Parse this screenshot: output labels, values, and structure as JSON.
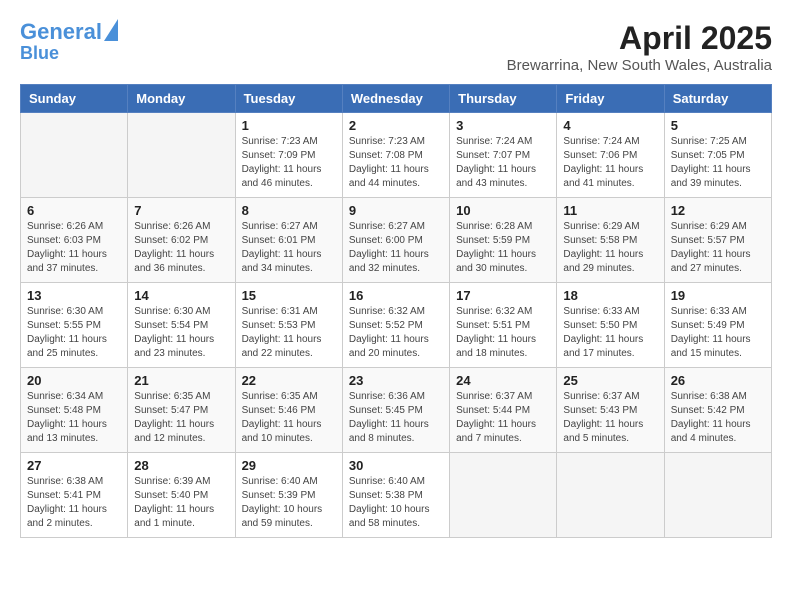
{
  "header": {
    "logo_line1": "General",
    "logo_line2": "Blue",
    "title": "April 2025",
    "subtitle": "Brewarrina, New South Wales, Australia"
  },
  "columns": [
    "Sunday",
    "Monday",
    "Tuesday",
    "Wednesday",
    "Thursday",
    "Friday",
    "Saturday"
  ],
  "weeks": [
    [
      {
        "day": "",
        "info": ""
      },
      {
        "day": "",
        "info": ""
      },
      {
        "day": "1",
        "info": "Sunrise: 7:23 AM\nSunset: 7:09 PM\nDaylight: 11 hours and 46 minutes."
      },
      {
        "day": "2",
        "info": "Sunrise: 7:23 AM\nSunset: 7:08 PM\nDaylight: 11 hours and 44 minutes."
      },
      {
        "day": "3",
        "info": "Sunrise: 7:24 AM\nSunset: 7:07 PM\nDaylight: 11 hours and 43 minutes."
      },
      {
        "day": "4",
        "info": "Sunrise: 7:24 AM\nSunset: 7:06 PM\nDaylight: 11 hours and 41 minutes."
      },
      {
        "day": "5",
        "info": "Sunrise: 7:25 AM\nSunset: 7:05 PM\nDaylight: 11 hours and 39 minutes."
      }
    ],
    [
      {
        "day": "6",
        "info": "Sunrise: 6:26 AM\nSunset: 6:03 PM\nDaylight: 11 hours and 37 minutes."
      },
      {
        "day": "7",
        "info": "Sunrise: 6:26 AM\nSunset: 6:02 PM\nDaylight: 11 hours and 36 minutes."
      },
      {
        "day": "8",
        "info": "Sunrise: 6:27 AM\nSunset: 6:01 PM\nDaylight: 11 hours and 34 minutes."
      },
      {
        "day": "9",
        "info": "Sunrise: 6:27 AM\nSunset: 6:00 PM\nDaylight: 11 hours and 32 minutes."
      },
      {
        "day": "10",
        "info": "Sunrise: 6:28 AM\nSunset: 5:59 PM\nDaylight: 11 hours and 30 minutes."
      },
      {
        "day": "11",
        "info": "Sunrise: 6:29 AM\nSunset: 5:58 PM\nDaylight: 11 hours and 29 minutes."
      },
      {
        "day": "12",
        "info": "Sunrise: 6:29 AM\nSunset: 5:57 PM\nDaylight: 11 hours and 27 minutes."
      }
    ],
    [
      {
        "day": "13",
        "info": "Sunrise: 6:30 AM\nSunset: 5:55 PM\nDaylight: 11 hours and 25 minutes."
      },
      {
        "day": "14",
        "info": "Sunrise: 6:30 AM\nSunset: 5:54 PM\nDaylight: 11 hours and 23 minutes."
      },
      {
        "day": "15",
        "info": "Sunrise: 6:31 AM\nSunset: 5:53 PM\nDaylight: 11 hours and 22 minutes."
      },
      {
        "day": "16",
        "info": "Sunrise: 6:32 AM\nSunset: 5:52 PM\nDaylight: 11 hours and 20 minutes."
      },
      {
        "day": "17",
        "info": "Sunrise: 6:32 AM\nSunset: 5:51 PM\nDaylight: 11 hours and 18 minutes."
      },
      {
        "day": "18",
        "info": "Sunrise: 6:33 AM\nSunset: 5:50 PM\nDaylight: 11 hours and 17 minutes."
      },
      {
        "day": "19",
        "info": "Sunrise: 6:33 AM\nSunset: 5:49 PM\nDaylight: 11 hours and 15 minutes."
      }
    ],
    [
      {
        "day": "20",
        "info": "Sunrise: 6:34 AM\nSunset: 5:48 PM\nDaylight: 11 hours and 13 minutes."
      },
      {
        "day": "21",
        "info": "Sunrise: 6:35 AM\nSunset: 5:47 PM\nDaylight: 11 hours and 12 minutes."
      },
      {
        "day": "22",
        "info": "Sunrise: 6:35 AM\nSunset: 5:46 PM\nDaylight: 11 hours and 10 minutes."
      },
      {
        "day": "23",
        "info": "Sunrise: 6:36 AM\nSunset: 5:45 PM\nDaylight: 11 hours and 8 minutes."
      },
      {
        "day": "24",
        "info": "Sunrise: 6:37 AM\nSunset: 5:44 PM\nDaylight: 11 hours and 7 minutes."
      },
      {
        "day": "25",
        "info": "Sunrise: 6:37 AM\nSunset: 5:43 PM\nDaylight: 11 hours and 5 minutes."
      },
      {
        "day": "26",
        "info": "Sunrise: 6:38 AM\nSunset: 5:42 PM\nDaylight: 11 hours and 4 minutes."
      }
    ],
    [
      {
        "day": "27",
        "info": "Sunrise: 6:38 AM\nSunset: 5:41 PM\nDaylight: 11 hours and 2 minutes."
      },
      {
        "day": "28",
        "info": "Sunrise: 6:39 AM\nSunset: 5:40 PM\nDaylight: 11 hours and 1 minute."
      },
      {
        "day": "29",
        "info": "Sunrise: 6:40 AM\nSunset: 5:39 PM\nDaylight: 10 hours and 59 minutes."
      },
      {
        "day": "30",
        "info": "Sunrise: 6:40 AM\nSunset: 5:38 PM\nDaylight: 10 hours and 58 minutes."
      },
      {
        "day": "",
        "info": ""
      },
      {
        "day": "",
        "info": ""
      },
      {
        "day": "",
        "info": ""
      }
    ]
  ]
}
